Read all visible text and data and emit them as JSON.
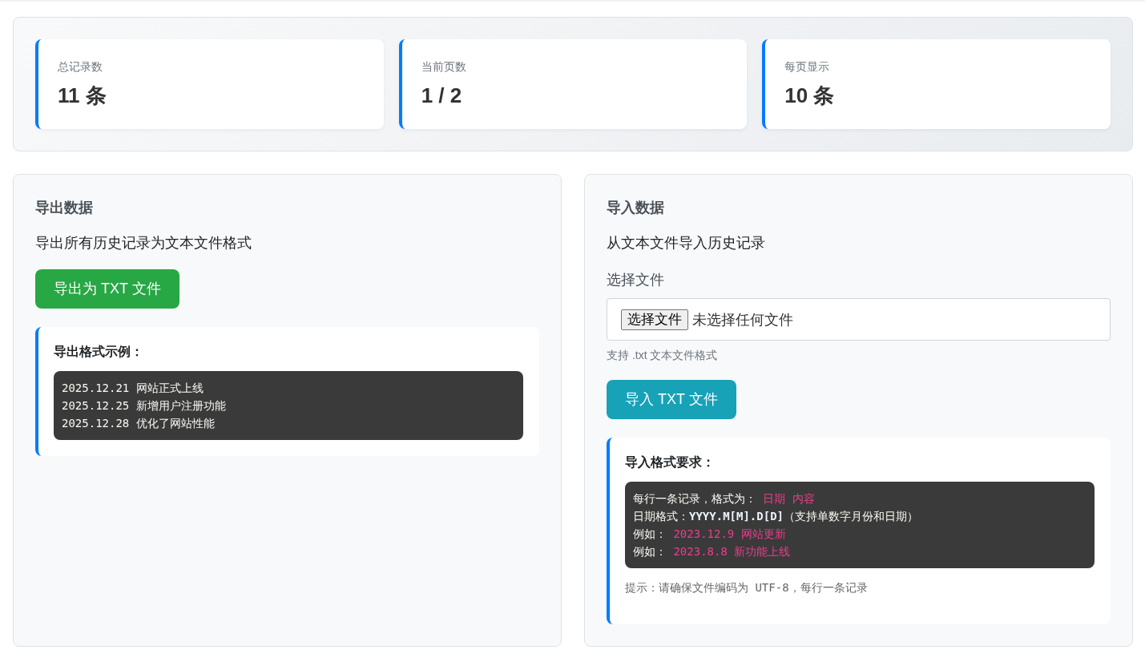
{
  "stats": [
    {
      "label": "总记录数",
      "value": "11 条"
    },
    {
      "label": "当前页数",
      "value": "1 / 2"
    },
    {
      "label": "每页显示",
      "value": "10 条"
    }
  ],
  "export_panel": {
    "title": "导出数据",
    "description": "导出所有历史记录为文本文件格式",
    "button": "导出为 TXT 文件",
    "example": {
      "title": "导出格式示例：",
      "lines": [
        "2025.12.21 网站正式上线",
        "2025.12.25 新增用户注册功能",
        "2025.12.28 优化了网站性能"
      ]
    }
  },
  "import_panel": {
    "title": "导入数据",
    "description": "从文本文件导入历史记录",
    "file_label": "选择文件",
    "file_input": {
      "button": "选择文件",
      "status": "未选择任何文件"
    },
    "hint": "支持 .txt 文本文件格式",
    "button": "导入 TXT 文件",
    "requirements": {
      "title": "导入格式要求：",
      "lines": [
        {
          "segments": [
            {
              "kind": "plain",
              "text": "每行一条记录，格式为： "
            },
            {
              "kind": "highlight",
              "text": "日期 内容"
            }
          ]
        },
        {
          "segments": [
            {
              "kind": "plain",
              "text": "日期格式："
            },
            {
              "kind": "strong",
              "text": "YYYY.M[M].D[D]"
            },
            {
              "kind": "plain",
              "text": "（支持单数字月份和日期）"
            }
          ]
        },
        {
          "segments": [
            {
              "kind": "plain",
              "text": "例如： "
            },
            {
              "kind": "highlight",
              "text": "2023.12.9 网站更新"
            }
          ]
        },
        {
          "segments": [
            {
              "kind": "plain",
              "text": "例如： "
            },
            {
              "kind": "highlight",
              "text": "2023.8.8 新功能上线"
            }
          ]
        }
      ],
      "tip": "提示：请确保文件编码为 UTF-8，每行一条记录"
    }
  }
}
